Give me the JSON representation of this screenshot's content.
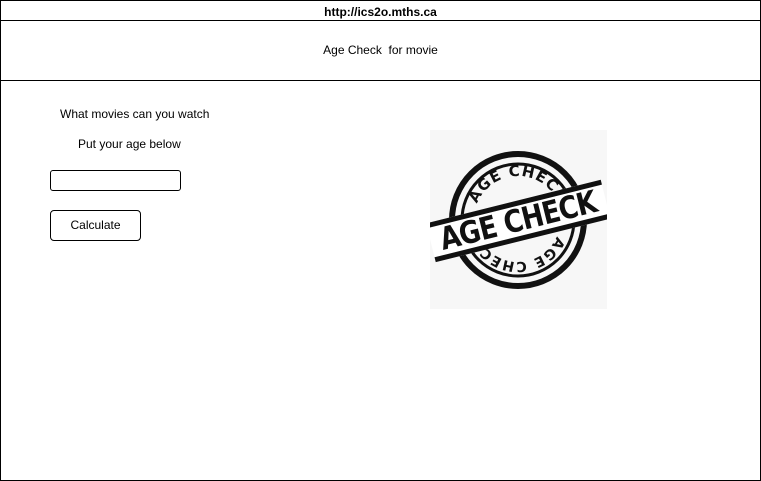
{
  "browser": {
    "url": "http://ics2o.mths.ca"
  },
  "header": {
    "title": "Age Check  for movie"
  },
  "form": {
    "question": "What movies can you watch",
    "instruction": "Put your age below",
    "age_input": {
      "value": "",
      "placeholder": ""
    },
    "calculate_label": "Calculate"
  },
  "stamp": {
    "icon": "age-check-stamp-icon",
    "text": "AGE CHECK",
    "color": "#111111"
  }
}
